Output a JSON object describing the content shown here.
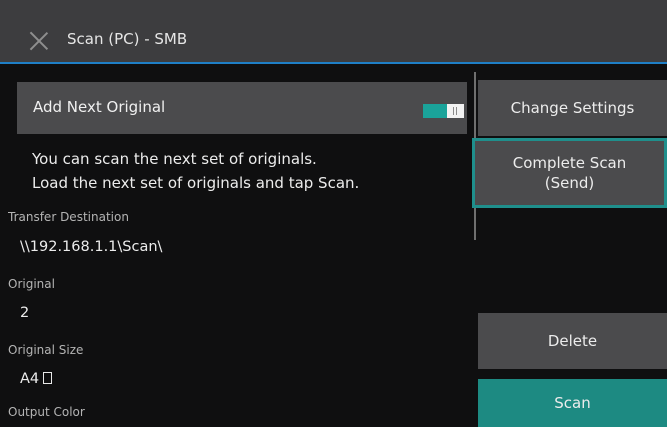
{
  "header": {
    "title": "Scan (PC) - SMB"
  },
  "add_next": {
    "label": "Add Next Original",
    "toggle_state": "on"
  },
  "message": {
    "line1": "You can scan the next set of originals.",
    "line2": "Load the next set of originals and tap Scan."
  },
  "fields": {
    "transfer_destination": {
      "label": "Transfer Destination",
      "value": "\\\\192.168.1.1\\Scan\\"
    },
    "original": {
      "label": "Original",
      "value": "2"
    },
    "original_size": {
      "label": "Original Size",
      "value": "A4",
      "orientation_icon": "portrait-icon"
    },
    "output_color": {
      "label": "Output Color"
    }
  },
  "buttons": {
    "change_settings": "Change Settings",
    "complete_scan_line1": "Complete Scan",
    "complete_scan_line2": "(Send)",
    "delete": "Delete",
    "scan": "Scan"
  },
  "colors": {
    "accent_teal": "#1d8a82",
    "header_underline": "#1f7fc6"
  }
}
